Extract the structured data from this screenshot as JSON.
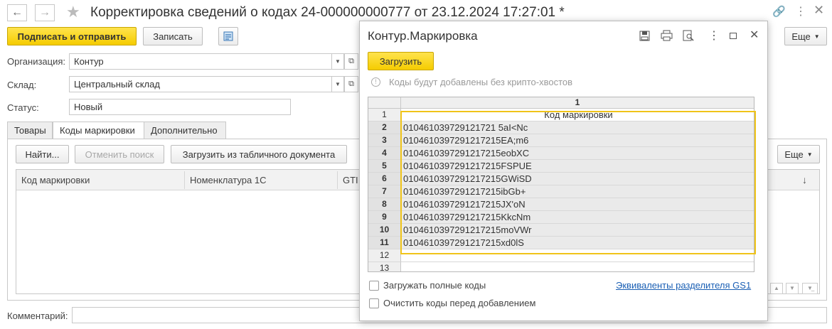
{
  "window": {
    "title": "Корректировка сведений о кодах 24-000000000777 от 23.12.2024 17:27:01 *"
  },
  "toolbar": {
    "sign_send_label": "Подписать и отправить",
    "save_label": "Записать",
    "more_label": "Еще"
  },
  "form": {
    "org_label": "Организация:",
    "org_value": "Контур",
    "warehouse_label": "Склад:",
    "warehouse_value": "Центральный склад",
    "status_label": "Статус:",
    "status_value": "Новый",
    "comment_label": "Комментарий:",
    "comment_value": ""
  },
  "tabs": [
    "Товары",
    "Коды маркировки",
    "Дополнительно"
  ],
  "tab_toolbar": {
    "find_label": "Найти...",
    "cancel_search_label": "Отменить поиск",
    "load_from_table_label": "Загрузить из табличного документа",
    "more_label": "Еще"
  },
  "table": {
    "columns": [
      "Код маркировки",
      "Номенклатура 1С",
      "GTI"
    ],
    "sort_indicator": "↓"
  },
  "dialog": {
    "title": "Контур.Маркировка",
    "load_button": "Загрузить",
    "info_text": "Коды будут добавлены без крипто-хвостов",
    "col_header": "1",
    "rows": [
      {
        "num": "1",
        "value": "Код маркировки"
      },
      {
        "num": "2",
        "value": "010461039729121721 5aI<Nc"
      },
      {
        "num": "3",
        "value": "0104610397291217215EA;m6"
      },
      {
        "num": "4",
        "value": "0104610397291217215eobXC"
      },
      {
        "num": "5",
        "value": "0104610397291217215FSPUE"
      },
      {
        "num": "6",
        "value": "0104610397291217215GWiSD"
      },
      {
        "num": "7",
        "value": "0104610397291217215ibGb+"
      },
      {
        "num": "8",
        "value": "0104610397291217215JX'oN"
      },
      {
        "num": "9",
        "value": "0104610397291217215KkcNm"
      },
      {
        "num": "10",
        "value": "0104610397291217215moVWr"
      },
      {
        "num": "11",
        "value": "0104610397291217215xd0lS"
      },
      {
        "num": "12",
        "value": ""
      },
      {
        "num": "13",
        "value": ""
      }
    ],
    "full_codes_label": "Загружать полные коды",
    "gs1_link": "Эквиваленты разделителя GS1",
    "clear_codes_label": "Очистить коды перед добавлением"
  },
  "colors": {
    "accent_yellow": "#f5cc00",
    "selection_border": "#f0c419",
    "link": "#1a5fb4"
  }
}
